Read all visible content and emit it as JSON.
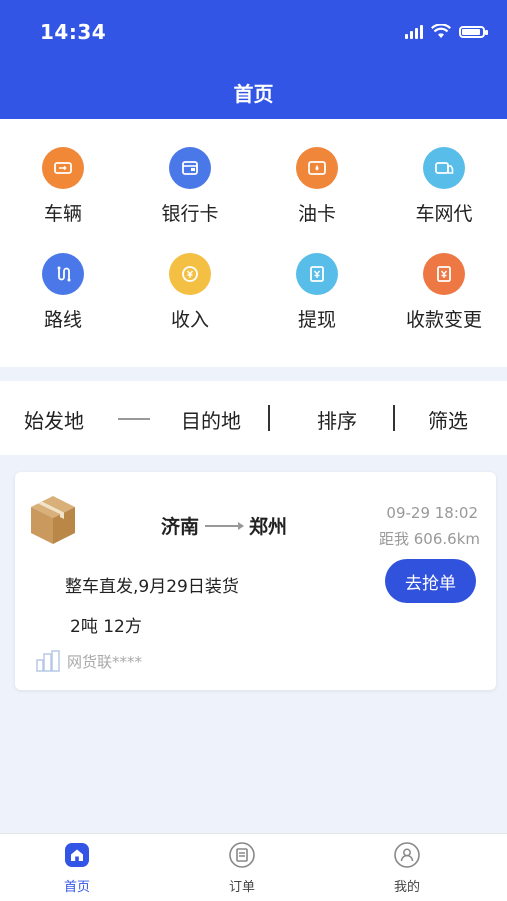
{
  "status": {
    "time": "14:34"
  },
  "header": {
    "title": "首页"
  },
  "grid": [
    {
      "label": "车辆",
      "icon": "truck-icon",
      "color": "#f08838"
    },
    {
      "label": "银行卡",
      "icon": "wallet-icon",
      "color": "#4a78e8"
    },
    {
      "label": "油卡",
      "icon": "fuel-card-icon",
      "color": "#f0863a"
    },
    {
      "label": "车网代",
      "icon": "car-network-icon",
      "color": "#58bde8"
    },
    {
      "label": "路线",
      "icon": "route-icon",
      "color": "#4a78e8"
    },
    {
      "label": "收入",
      "icon": "income-icon",
      "color": "#f4c044"
    },
    {
      "label": "提现",
      "icon": "withdraw-icon",
      "color": "#58bde8"
    },
    {
      "label": "收款变更",
      "icon": "payee-change-icon",
      "color": "#ee7844"
    }
  ],
  "filters": {
    "origin": "始发地",
    "destination": "目的地",
    "sort": "排序",
    "filter": "筛选"
  },
  "order": {
    "from": "济南",
    "to": "郑州",
    "time": "09-29 18:02",
    "distance": "距我 606.6km",
    "description": "整车直发,9月29日装货",
    "weight": "2吨 12方",
    "button": "去抢单",
    "source": "网货联****"
  },
  "tabs": [
    {
      "label": "首页",
      "icon": "home-icon",
      "active": true
    },
    {
      "label": "订单",
      "icon": "order-icon",
      "active": false
    },
    {
      "label": "我的",
      "icon": "profile-icon",
      "active": false
    }
  ],
  "colors": {
    "primary": "#3355e6",
    "background": "#eef2fb"
  }
}
